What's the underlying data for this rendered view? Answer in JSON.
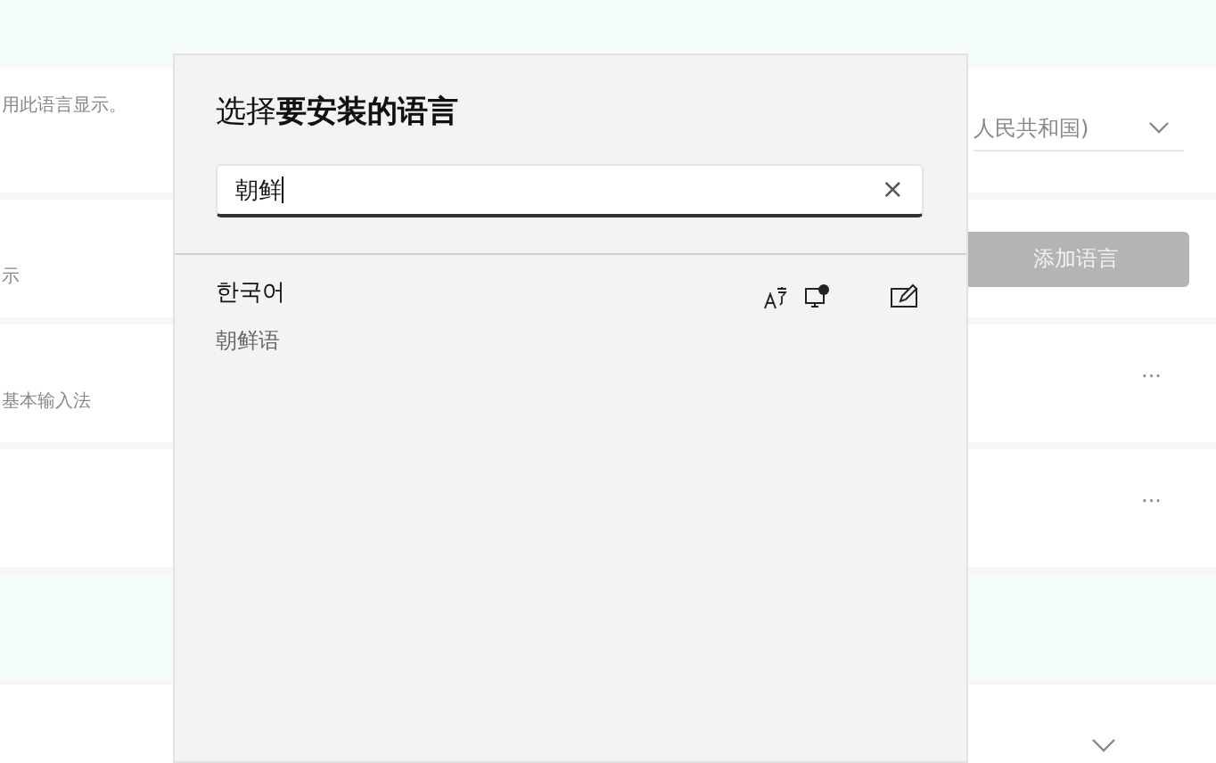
{
  "background_page": {
    "rows": [
      {
        "text": "用此语言显示。",
        "dropdown": "人民共和国)"
      },
      {
        "text": "示",
        "button": "添加语言"
      },
      {
        "text": "基本输入法",
        "more": "···"
      },
      {
        "more": "···"
      }
    ]
  },
  "dialog": {
    "title": "选择**要安装的语言**",
    "search": {
      "value": "朝鲜",
      "clear": "×"
    },
    "results": [
      {
        "name": "한국어",
        "subtitle": "朝鲜语"
      }
    ]
  }
}
